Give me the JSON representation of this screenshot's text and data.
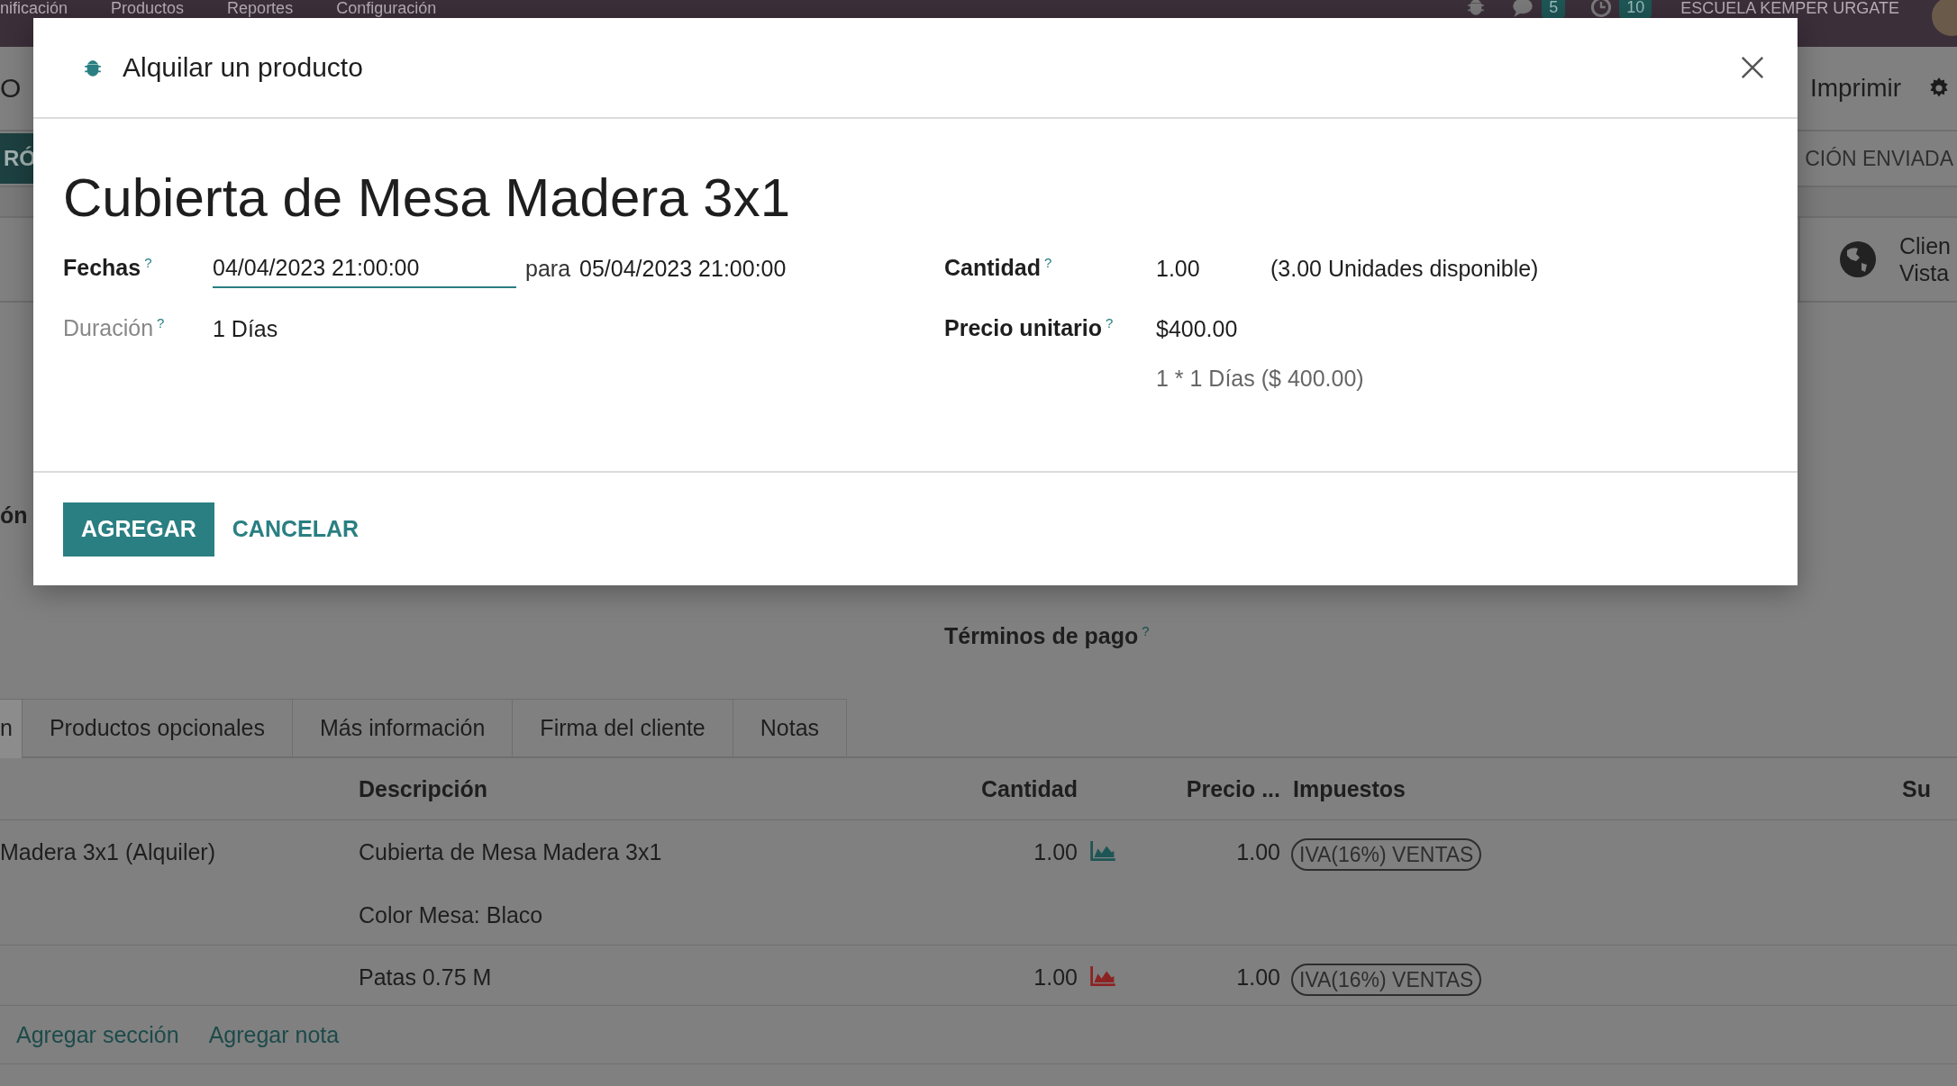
{
  "navbar": {
    "menu": [
      "nificación",
      "Productos",
      "Reportes",
      "Configuración"
    ],
    "messages_count": "5",
    "activities_count": "10",
    "company": "ESCUELA KEMPER URGATE"
  },
  "control_panel": {
    "breadcrumb": "O",
    "print": "Imprimir"
  },
  "statusbar": {
    "action": "RÓ",
    "stage": "CIÓN ENVIADA"
  },
  "stat_button": {
    "lines": [
      "Clien",
      "Vista"
    ]
  },
  "form": {
    "left_label": "ón",
    "payment_terms": {
      "label": "Términos de pago",
      "help": "?"
    }
  },
  "tabs": [
    {
      "label": "n",
      "selected": true
    },
    {
      "label": "Productos opcionales",
      "selected": false
    },
    {
      "label": "Más información",
      "selected": false
    },
    {
      "label": "Firma del cliente",
      "selected": false
    },
    {
      "label": "Notas",
      "selected": false
    }
  ],
  "table": {
    "columns": {
      "description": "Descripción",
      "quantity": "Cantidad",
      "price": "Precio ...",
      "taxes": "Impuestos",
      "subtotal": "Su"
    },
    "rows": [
      {
        "product": "Madera 3x1 (Alquiler)",
        "description": "Cubierta de Mesa Madera 3x1",
        "note": "Color Mesa: Blaco",
        "quantity": "1.00",
        "color": "#1e5656",
        "price": "1.00",
        "tax": "IVA(16%) VENTAS"
      },
      {
        "description": "Patas 0.75 M",
        "quantity": "1.00",
        "color": "#8c2323",
        "price": "1.00",
        "tax": "IVA(16%) VENTAS"
      }
    ],
    "actions": [
      "Agregar sección",
      "Agregar nota"
    ]
  },
  "dialog": {
    "title": "Alquilar un producto",
    "product": "Cubierta de Mesa Madera 3x1",
    "dates": {
      "label": "Fechas",
      "help": "?",
      "start": "04/04/2023 21:00:00",
      "separator": "para",
      "end": "05/04/2023 21:00:00"
    },
    "duration": {
      "label": "Duración",
      "help": "?",
      "muted": true,
      "value": "1 Días"
    },
    "quantity": {
      "label": "Cantidad",
      "help": "?",
      "value": "1.00",
      "availability": "(3.00 Unidades disponible)"
    },
    "unit_price": {
      "label": "Precio unitario",
      "help": "?",
      "value": "$400.00",
      "detail": "1 * 1 Días ($ 400.00)"
    },
    "buttons": [
      {
        "label": "AGREGAR",
        "kind": "primary"
      },
      {
        "label": "CANCELAR",
        "kind": "link"
      }
    ]
  }
}
